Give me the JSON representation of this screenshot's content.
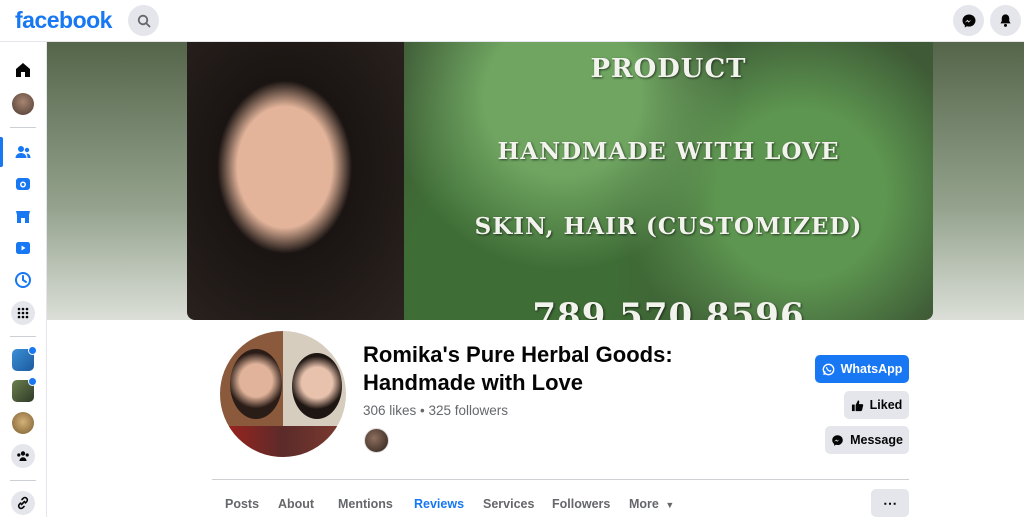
{
  "app": {
    "logo": "facebook"
  },
  "topbar": {
    "search_icon": "search-icon",
    "right_icons": [
      "messenger-icon",
      "notifications-icon"
    ]
  },
  "rail": {
    "items": [
      "home-icon",
      "profile-thumb",
      "friends-icon",
      "memories-icon",
      "marketplace-icon",
      "watch-icon",
      "feeds-icon",
      "apps-icon",
      "group-thumb-1",
      "group-thumb-2",
      "group-thumb-3",
      "groups-icon",
      "link-icon"
    ]
  },
  "cover": {
    "lines": [
      "PRODUCT",
      "HANDMADE WITH LOVE",
      "SKIN, HAIR (CUSTOMIZED)",
      "789 570 8596"
    ]
  },
  "page": {
    "title": "Romika's Pure Herbal Goods: Handmade with Love",
    "stats": "306 likes • 325 followers"
  },
  "actions": {
    "whatsapp": "WhatsApp",
    "liked": "Liked",
    "message": "Message"
  },
  "tabs": [
    "Posts",
    "About",
    "Mentions",
    "Reviews",
    "Services",
    "Followers",
    "More"
  ],
  "active_tab": "Reviews",
  "colors": {
    "brand": "#1877f2",
    "secondary_button": "#e4e6eb"
  }
}
